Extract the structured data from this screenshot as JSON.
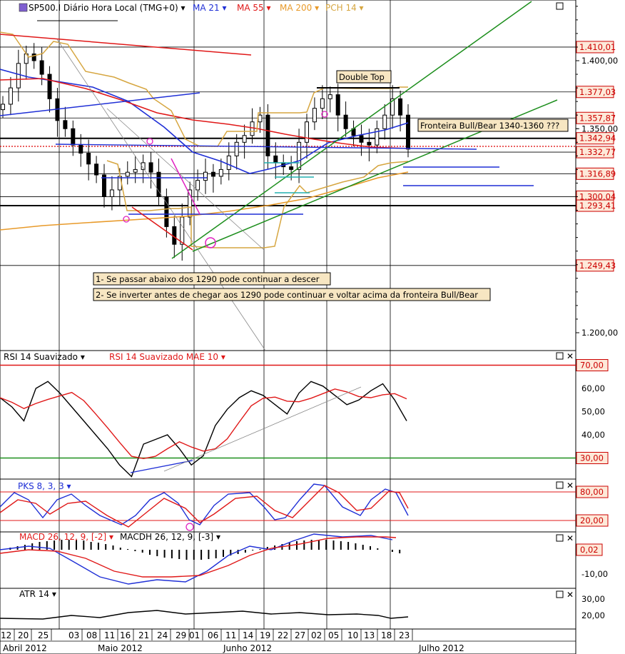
{
  "header": {
    "symbol": "SP500.I Diário Hora Local (TMG+0)",
    "indicators": [
      {
        "label": "MA 21",
        "color": "#1f2fd6"
      },
      {
        "label": "MA 55",
        "color": "#e01818"
      },
      {
        "label": "MA 200",
        "color": "#e89a2a"
      },
      {
        "label": "PCH 14",
        "color": "#d6a640"
      }
    ]
  },
  "price_panel": {
    "price_labels": [
      "1.410,01",
      "1.377,03",
      "1.357,87",
      "1.342,94",
      "1.332,77",
      "1.316,89",
      "1.300,04",
      "1.293,41",
      "1.249,43"
    ],
    "axis_ticks": [
      "1.400,00",
      "1.350,00",
      "1.200,00"
    ],
    "annotations": {
      "double_top": "Double Top",
      "fronteira": "Fronteira Bull/Bear 1340-1360 ???",
      "note1": "1- Se passar abaixo dos 1290 pode continuar a descer",
      "note2": "2- Se inverter antes de chegar aos 1290 pode continuar e voltar acima da fronteira Bull/Bear"
    }
  },
  "rsi_panel": {
    "title": "RSI 14 Suavizado",
    "title2": "RSI 14 Suavizado MAE 10",
    "levels": [
      "70,00",
      "30,00"
    ],
    "ticks": [
      "60,00",
      "50,00",
      "40,00"
    ]
  },
  "pks_panel": {
    "title": "PKS 8, 3, 3",
    "levels": [
      "80,00",
      "20,00"
    ]
  },
  "macd_panel": {
    "title": "MACD 26, 12, 9, [-2]",
    "title2": "MACDH 26, 12, 9, [-3]",
    "value": "0,02",
    "tick": "-10,00"
  },
  "atr_panel": {
    "title": "ATR 14",
    "ticks": [
      "30,00",
      "20,00"
    ]
  },
  "x_axis": {
    "days": [
      "12",
      "20",
      "25",
      "03",
      "08",
      "11",
      "16",
      "21",
      "24",
      "29",
      "01",
      "06",
      "11",
      "14",
      "19",
      "22",
      "27",
      "02",
      "05",
      "10",
      "13",
      "18",
      "23"
    ],
    "months": [
      "Abril 2012",
      "Maio 2012",
      "Junho 2012",
      "Julho 2012"
    ]
  },
  "chart_data": {
    "type": "candlestick",
    "title": "SP500.I Diário Hora Local (TMG+0)",
    "close_approx": [
      1368,
      1380,
      1398,
      1405,
      1400,
      1390,
      1372,
      1356,
      1350,
      1338,
      1332,
      1324,
      1316,
      1300,
      1305,
      1315,
      1318,
      1320,
      1325,
      1318,
      1300,
      1278,
      1265,
      1285,
      1305,
      1312,
      1318,
      1315,
      1320,
      1330,
      1340,
      1345,
      1355,
      1360,
      1330,
      1325,
      1322,
      1320,
      1340,
      1355,
      1365,
      1372,
      1375,
      1360,
      1350,
      1345,
      1340,
      1338,
      1350,
      1360,
      1372,
      1360,
      1335
    ],
    "rsi_approx": [
      56,
      52,
      46,
      60,
      63,
      58,
      52,
      46,
      40,
      34,
      27,
      22,
      36,
      38,
      40,
      34,
      27,
      31,
      44,
      51,
      56,
      59,
      57,
      53,
      49,
      58,
      63,
      61,
      57,
      53,
      55,
      59,
      62,
      55,
      46
    ],
    "ylim": [
      1180,
      1440
    ]
  }
}
